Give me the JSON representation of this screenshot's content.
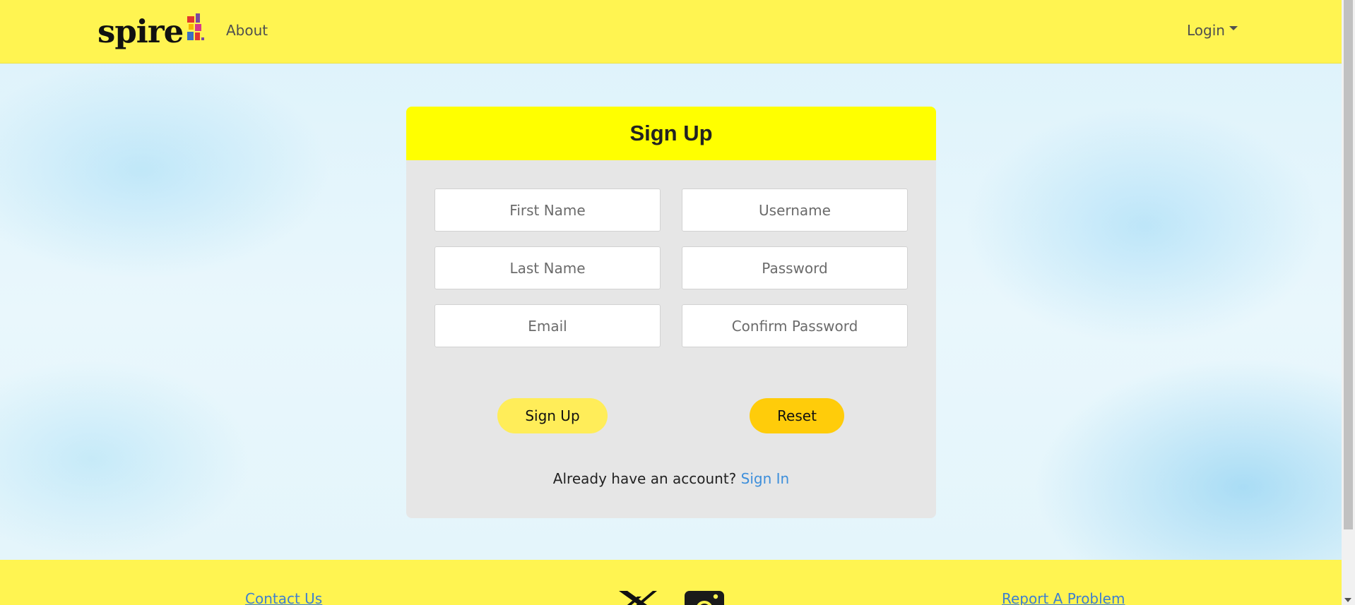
{
  "nav": {
    "logo_text": "spire",
    "about_label": "About",
    "login_label": "Login"
  },
  "form": {
    "title": "Sign Up",
    "fields": {
      "first_name": "First Name",
      "username": "Username",
      "last_name": "Last Name",
      "password": "Password",
      "email": "Email",
      "confirm_password": "Confirm Password"
    },
    "signup_label": "Sign Up",
    "reset_label": "Reset",
    "account_prompt": "Already have an account?",
    "signin_label": "Sign In"
  },
  "footer": {
    "contact_label": "Contact Us",
    "report_label": "Report A Problem",
    "icons": [
      "x-icon",
      "instagram-icon"
    ]
  },
  "colors": {
    "nav_bg": "#fff451",
    "card_header_bg": "#ffff00",
    "card_bg": "#e6e6e6",
    "signup_button": "#ffed59",
    "reset_button": "#ffcc0a",
    "link": "#3e8fdb"
  }
}
